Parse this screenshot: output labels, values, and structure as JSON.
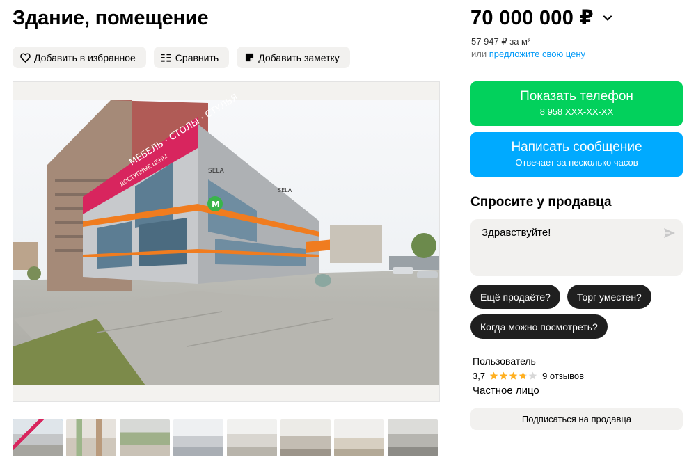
{
  "listing": {
    "title": "Здание, помещение"
  },
  "actions": {
    "favorite_label": "Добавить в избранное",
    "compare_label": "Сравнить",
    "note_label": "Добавить заметку"
  },
  "photo": {
    "signs": {
      "main": "МЕБЕЛЬ · СТОЛЫ · СТУЛЬЯ",
      "sub": "ДОСТУПНЫЕ ЦЕНЫ",
      "brand": "SELA",
      "brand2": "SELA",
      "logo": "M"
    }
  },
  "price": {
    "value": "70 000 000 ₽",
    "per_sqm": "57 947 ₽ за м²",
    "offer_prefix": "или",
    "offer_link": "предложите свою цену"
  },
  "contact": {
    "phone_button_label": "Показать телефон",
    "phone_masked": "8 958 XXX-XX-XX",
    "message_button_label": "Написать сообщение",
    "message_button_sub": "Отвечает за несколько часов"
  },
  "ask": {
    "title": "Спросите у продавца",
    "message_value": "Здравствуйте!",
    "quick_replies": [
      "Ещё продаёте?",
      "Торг уместен?",
      "Когда можно посмотреть?"
    ]
  },
  "seller": {
    "name": "Пользователь",
    "rating": "3,7",
    "rating_value": 3.7,
    "rating_max": 5,
    "reviews": "9 отзывов",
    "type": "Частное лицо",
    "subscribe_label": "Подписаться на продавца"
  },
  "colors": {
    "phone_button": "#02d15c",
    "message_button": "#00aaff",
    "link": "#0099f7",
    "chip": "#1f1f1f",
    "star_filled": "#ffb021",
    "star_empty": "#d8d8d8",
    "thumb_active_border": "#0aa1ff"
  },
  "icons": {
    "favorite": "heart-icon",
    "compare": "compare-icon",
    "note": "note-icon",
    "price_toggle": "chevron-down-icon",
    "send": "send-icon",
    "star": "star-icon"
  }
}
